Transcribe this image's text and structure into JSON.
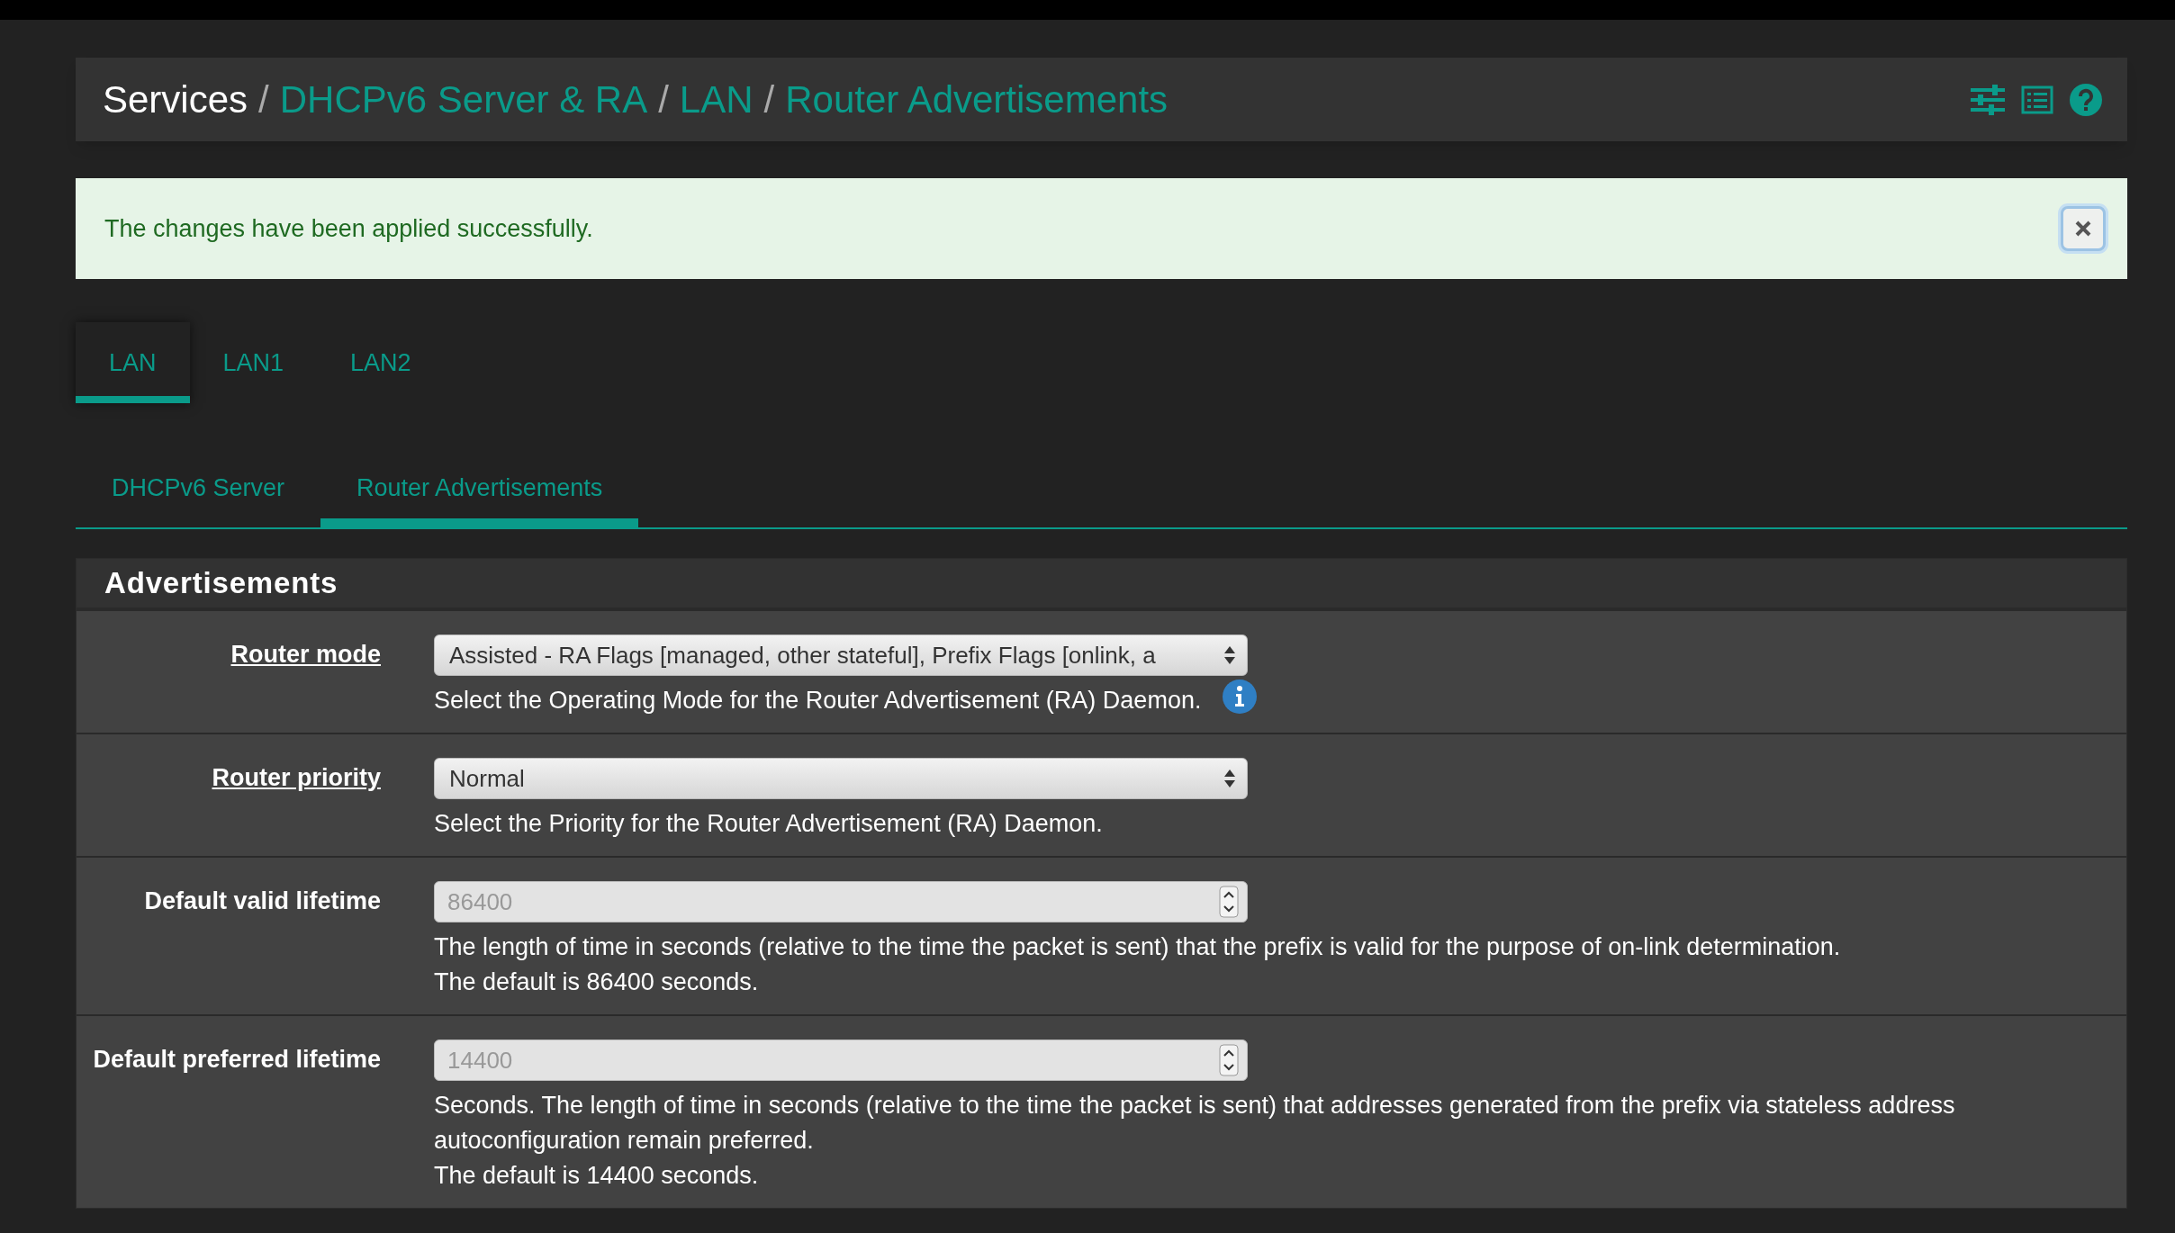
{
  "breadcrumb": [
    {
      "label": "Services",
      "link": false
    },
    {
      "label": "DHCPv6 Server & RA",
      "link": true,
      "separator": "/"
    },
    {
      "label": "LAN",
      "link": true,
      "separator": "/"
    },
    {
      "label": "Router Advertisements",
      "link": true,
      "separator": "/"
    }
  ],
  "alert": {
    "message": "The changes have been applied successfully."
  },
  "interface_tabs": [
    {
      "label": "LAN",
      "selected": true
    },
    {
      "label": "LAN1",
      "selected": false
    },
    {
      "label": "LAN2",
      "selected": false
    }
  ],
  "section_tabs": [
    {
      "label": "DHCPv6 Server",
      "selected": false
    },
    {
      "label": "Router Advertisements",
      "selected": true
    }
  ],
  "panel": {
    "title": "Advertisements",
    "rows": [
      {
        "label": "Router mode",
        "label_link": true,
        "field": {
          "kind": "select",
          "value": "Assisted - RA Flags [managed, other stateful], Prefix Flags [onlink, a"
        },
        "help": [
          "Select the Operating Mode for the Router Advertisement (RA) Daemon."
        ],
        "info": true
      },
      {
        "label": "Router priority",
        "label_link": true,
        "field": {
          "kind": "select",
          "value": "Normal"
        },
        "help": [
          "Select the Priority for the Router Advertisement (RA) Daemon."
        ],
        "info": false
      },
      {
        "label": "Default valid lifetime",
        "label_link": false,
        "field": {
          "kind": "number",
          "placeholder": "86400"
        },
        "help": [
          "The length of time in seconds (relative to the time the packet is sent) that the prefix is valid for the purpose of on-link determination.",
          "The default is 86400 seconds."
        ],
        "info": false
      },
      {
        "label": "Default preferred lifetime",
        "label_link": false,
        "field": {
          "kind": "number",
          "placeholder": "14400"
        },
        "help": [
          "Seconds. The length of time in seconds (relative to the time the packet is sent) that addresses generated from the prefix via stateless address autoconfiguration remain preferred.",
          "The default is 14400 seconds."
        ],
        "info": false
      }
    ]
  }
}
